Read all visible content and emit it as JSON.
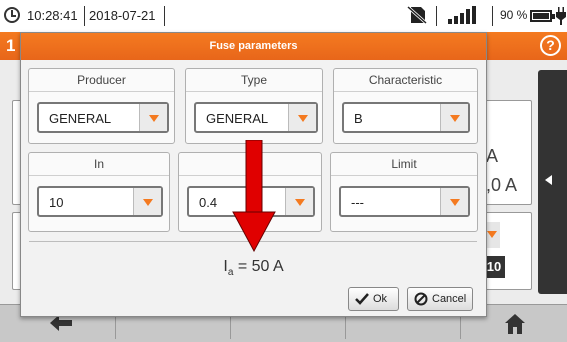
{
  "status_bar": {
    "time": "10:28:41",
    "date": "2018-07-21",
    "battery_percent": "90 %",
    "icons": [
      "clock-icon",
      "no-sd-card-icon",
      "signal-strength-icon",
      "battery-icon",
      "charging-plug-icon"
    ]
  },
  "background": {
    "header_number": "1",
    "help_label": "?",
    "values": {
      "line1": "A",
      "line2": ",0 A",
      "badge": "10"
    }
  },
  "dialog": {
    "title": "Fuse parameters",
    "fields": {
      "producer": {
        "label": "Producer",
        "value": "GENERAL"
      },
      "type": {
        "label": "Type",
        "value": "GENERAL"
      },
      "characteristic": {
        "label": "Characteristic",
        "value": "B"
      },
      "in": {
        "label": "In",
        "value": "10"
      },
      "t": {
        "label": "T",
        "value": "0.4"
      },
      "limit": {
        "label": "Limit",
        "value": "---"
      }
    },
    "result": {
      "symbol": "I",
      "subscript": "a",
      "text": " = 50 A"
    },
    "ok_label": "Ok",
    "cancel_label": "Cancel"
  },
  "colors": {
    "accent": "#f47a20",
    "annotation_arrow": "#e00000",
    "dark_panel": "#333333"
  }
}
